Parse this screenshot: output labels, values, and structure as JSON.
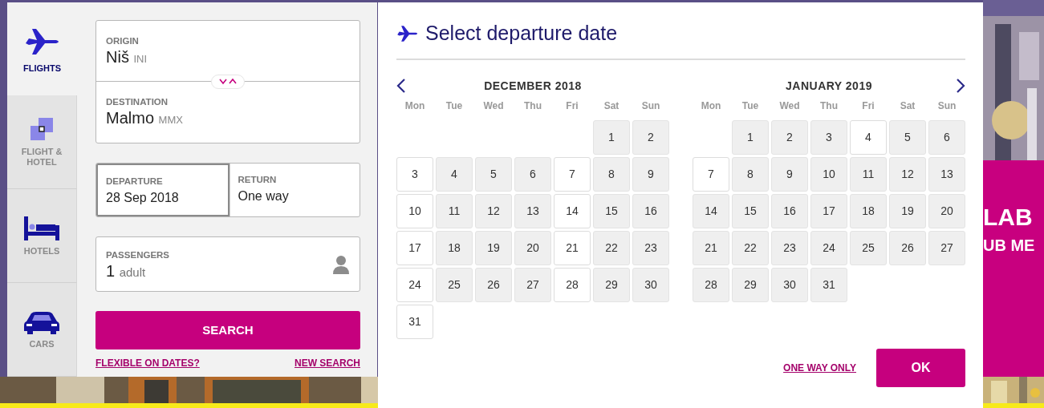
{
  "booking_tabs": [
    {
      "label": "FLIGHTS",
      "kind": "plane",
      "selected": true
    },
    {
      "label": "FLIGHT & HOTEL",
      "kind": "plane-hotel",
      "selected": false
    },
    {
      "label": "HOTELS",
      "kind": "bed",
      "selected": false
    },
    {
      "label": "CARS",
      "kind": "car",
      "selected": false
    }
  ],
  "route": {
    "origin": {
      "label": "ORIGIN",
      "city": "Niš",
      "code": "INI"
    },
    "destination": {
      "label": "DESTINATION",
      "city": "Malmo",
      "code": "MMX"
    }
  },
  "dates": [
    {
      "label": "DEPARTURE",
      "value": "28 Sep 2018",
      "selected": true
    },
    {
      "label": "RETURN",
      "value": "One way",
      "selected": false
    }
  ],
  "passengers": {
    "label": "PASSENGERS",
    "count": "1",
    "unit": "adult"
  },
  "search_button": "SEARCH",
  "links": [
    "FLEXIBLE ON DATES?",
    "NEW SEARCH"
  ],
  "picker": {
    "title": "Select departure date",
    "months": [
      {
        "title": "DECEMBER 2018",
        "weekdays": [
          "Mon",
          "Tue",
          "Wed",
          "Thu",
          "Fri",
          "Sat",
          "Sun"
        ],
        "weeks": [
          {
            "right_aligned": true,
            "days": [
              {
                "day": "1",
                "available": false
              },
              {
                "day": "2",
                "available": false
              }
            ]
          },
          {
            "days": [
              {
                "day": "3",
                "available": true
              },
              {
                "day": "4",
                "available": false
              },
              {
                "day": "5",
                "available": false
              },
              {
                "day": "6",
                "available": false
              },
              {
                "day": "7",
                "available": true
              },
              {
                "day": "8",
                "available": false
              },
              {
                "day": "9",
                "available": false
              }
            ]
          },
          {
            "days": [
              {
                "day": "10",
                "available": true
              },
              {
                "day": "11",
                "available": false
              },
              {
                "day": "12",
                "available": false
              },
              {
                "day": "13",
                "available": false
              },
              {
                "day": "14",
                "available": true
              },
              {
                "day": "15",
                "available": false
              },
              {
                "day": "16",
                "available": false
              }
            ]
          },
          {
            "days": [
              {
                "day": "17",
                "available": true
              },
              {
                "day": "18",
                "available": false
              },
              {
                "day": "19",
                "available": false
              },
              {
                "day": "20",
                "available": false
              },
              {
                "day": "21",
                "available": true
              },
              {
                "day": "22",
                "available": false
              },
              {
                "day": "23",
                "available": false
              }
            ]
          },
          {
            "days": [
              {
                "day": "24",
                "available": true
              },
              {
                "day": "25",
                "available": false
              },
              {
                "day": "26",
                "available": false
              },
              {
                "day": "27",
                "available": false
              },
              {
                "day": "28",
                "available": true
              },
              {
                "day": "29",
                "available": false
              },
              {
                "day": "30",
                "available": false
              }
            ]
          },
          {
            "days": [
              {
                "day": "31",
                "available": true
              }
            ]
          }
        ]
      },
      {
        "title": "JANUARY 2019",
        "weekdays": [
          "Mon",
          "Tue",
          "Wed",
          "Thu",
          "Fri",
          "Sat",
          "Sun"
        ],
        "weeks": [
          {
            "right_aligned": true,
            "days": [
              {
                "day": "1",
                "available": false
              },
              {
                "day": "2",
                "available": false
              },
              {
                "day": "3",
                "available": false
              },
              {
                "day": "4",
                "available": true
              },
              {
                "day": "5",
                "available": false
              },
              {
                "day": "6",
                "available": false
              }
            ]
          },
          {
            "days": [
              {
                "day": "7",
                "available": true
              },
              {
                "day": "8",
                "available": false
              },
              {
                "day": "9",
                "available": false
              },
              {
                "day": "10",
                "available": false
              },
              {
                "day": "11",
                "available": false
              },
              {
                "day": "12",
                "available": false
              },
              {
                "day": "13",
                "available": false
              }
            ]
          },
          {
            "days": [
              {
                "day": "14",
                "available": false
              },
              {
                "day": "15",
                "available": false
              },
              {
                "day": "16",
                "available": false
              },
              {
                "day": "17",
                "available": false
              },
              {
                "day": "18",
                "available": false
              },
              {
                "day": "19",
                "available": false
              },
              {
                "day": "20",
                "available": false
              }
            ]
          },
          {
            "days": [
              {
                "day": "21",
                "available": false
              },
              {
                "day": "22",
                "available": false
              },
              {
                "day": "23",
                "available": false
              },
              {
                "day": "24",
                "available": false
              },
              {
                "day": "25",
                "available": false
              },
              {
                "day": "26",
                "available": false
              },
              {
                "day": "27",
                "available": false
              }
            ]
          },
          {
            "days": [
              {
                "day": "28",
                "available": false
              },
              {
                "day": "29",
                "available": false
              },
              {
                "day": "30",
                "available": false
              },
              {
                "day": "31",
                "available": false
              }
            ]
          }
        ]
      }
    ],
    "footer_link": "ONE WAY ONLY",
    "ok_button": "OK"
  },
  "banner": {
    "lines": [
      "LAB",
      "UB ME"
    ]
  }
}
